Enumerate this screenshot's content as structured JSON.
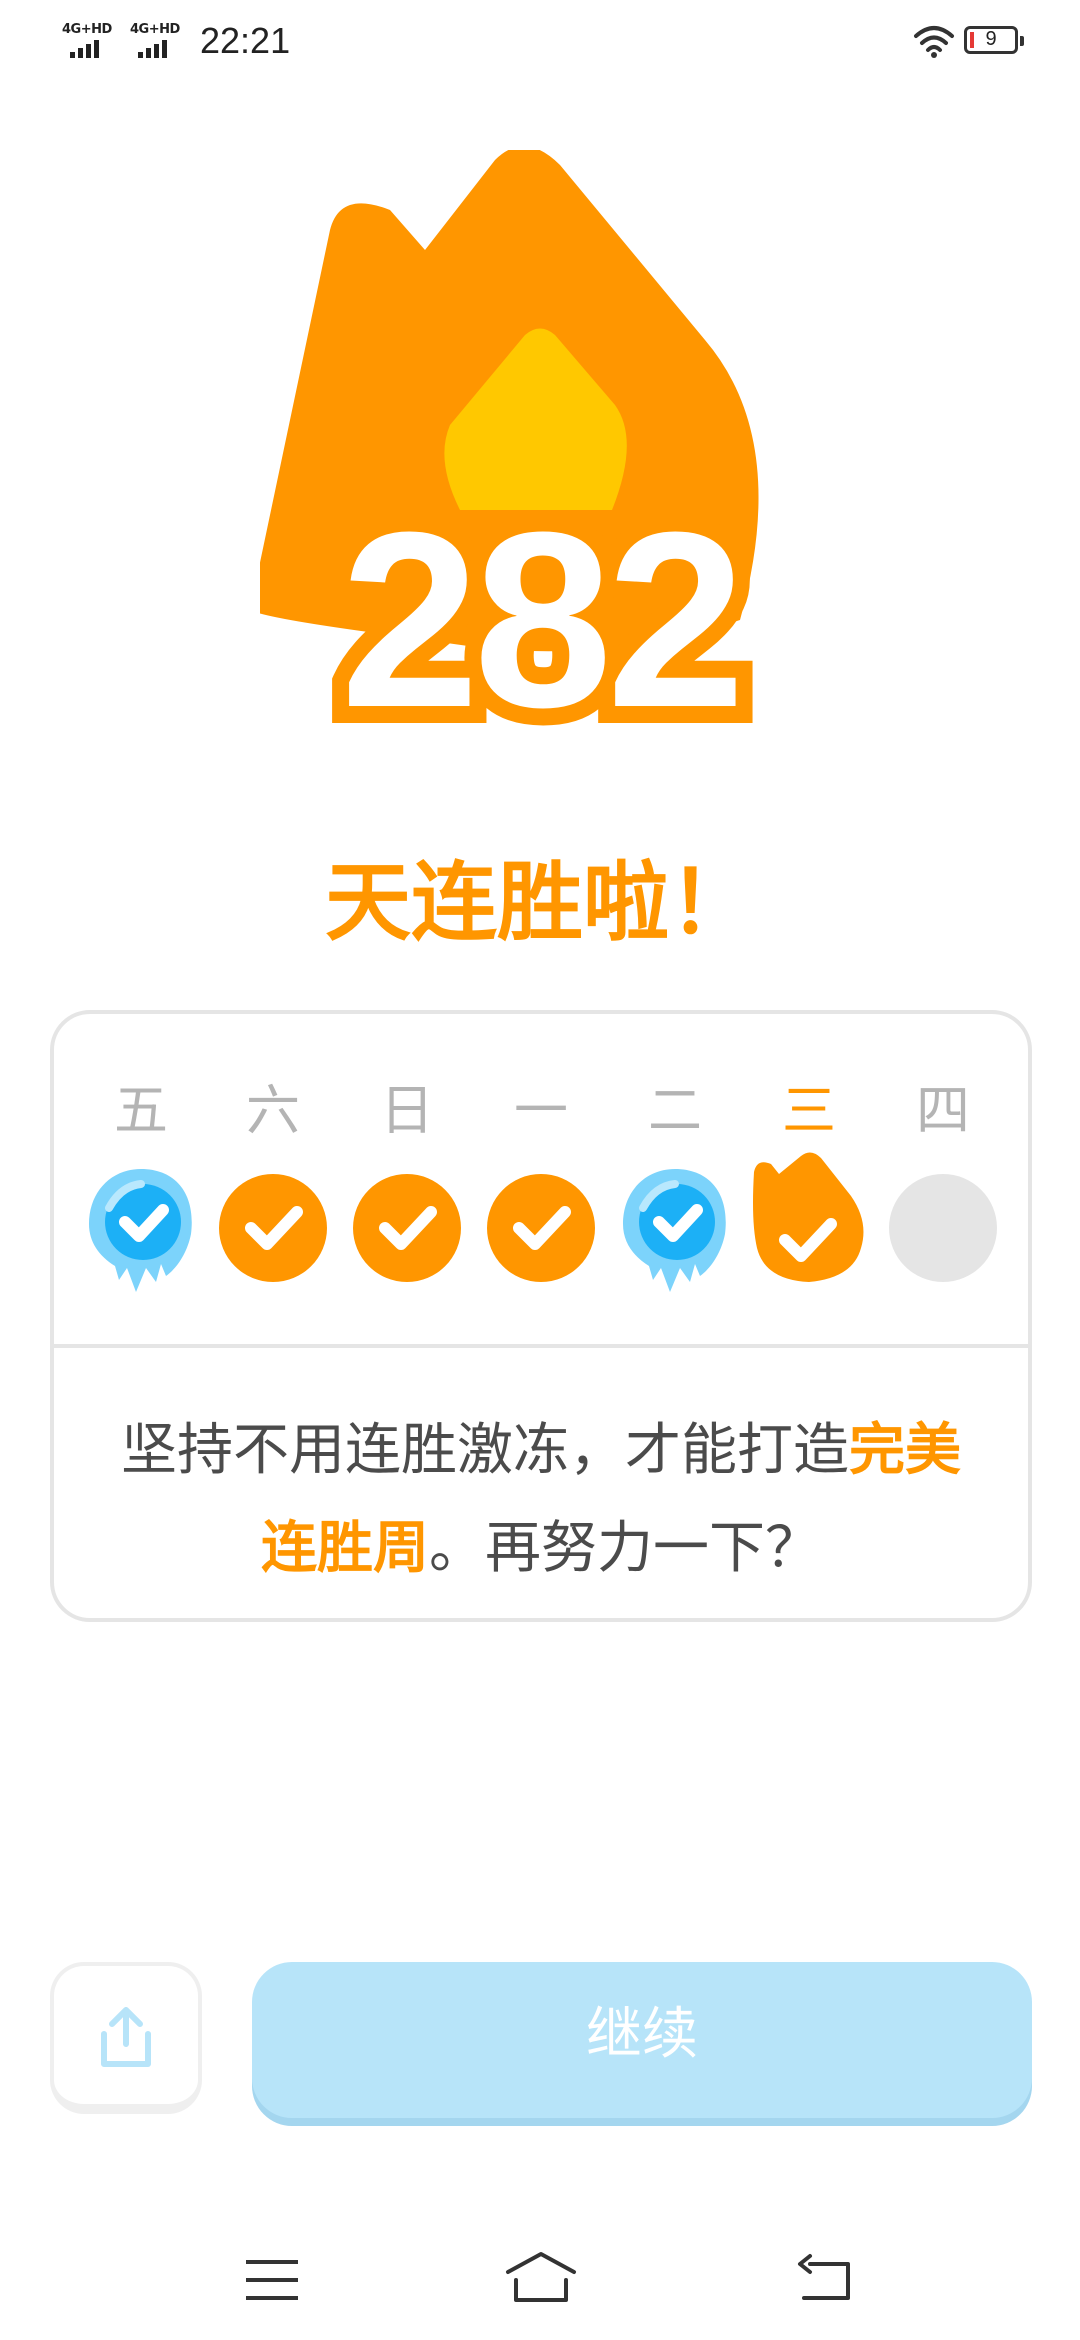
{
  "status_bar": {
    "network_1": "4G+HD",
    "network_2": "4G+HD",
    "time": "22:21",
    "battery_level": "9"
  },
  "streak": {
    "count": "282",
    "caption": "天连胜啦！"
  },
  "week": {
    "days": [
      {
        "label": "五",
        "status": "freeze"
      },
      {
        "label": "六",
        "status": "done"
      },
      {
        "label": "日",
        "status": "done"
      },
      {
        "label": "一",
        "status": "done"
      },
      {
        "label": "二",
        "status": "freeze"
      },
      {
        "label": "三",
        "status": "today-done"
      },
      {
        "label": "四",
        "status": "upcoming"
      }
    ],
    "message_part1": "坚持不用连胜激冻，才能打造",
    "message_highlight": "完美连胜周",
    "message_part2": "。再努力一下？"
  },
  "actions": {
    "continue_label": "继续"
  },
  "colors": {
    "streak_orange": "#ff9600",
    "flame_inner": "#ffc800",
    "freeze_blue": "#1cb0f6",
    "continue_bg": "#b7e4f9",
    "muted_gray": "#b4b4b4"
  }
}
